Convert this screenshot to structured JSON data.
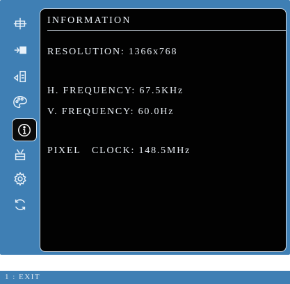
{
  "sidebar": {
    "items": [
      {
        "icon": "brightness-contrast-icon"
      },
      {
        "icon": "input-select-icon"
      },
      {
        "icon": "audio-adjust-icon"
      },
      {
        "icon": "color-adjust-icon"
      },
      {
        "icon": "information-icon",
        "selected": true
      },
      {
        "icon": "manual-image-adjust-icon"
      },
      {
        "icon": "setup-menu-icon"
      },
      {
        "icon": "memory-recall-icon"
      }
    ]
  },
  "panel": {
    "title": "INFORMATION",
    "lines": [
      "RESOLUTION: 1366x768",
      "H. FREQUENCY: 67.5KHz",
      "V. FREQUENCY: 60.0Hz",
      "PIXEL   CLOCK: 148.5MHz"
    ]
  },
  "status_bar": {
    "text": "1 : EXIT"
  },
  "colors": {
    "osd_background": "#3f7fb4",
    "panel_background": "#020202",
    "text": "#e8eef4"
  }
}
